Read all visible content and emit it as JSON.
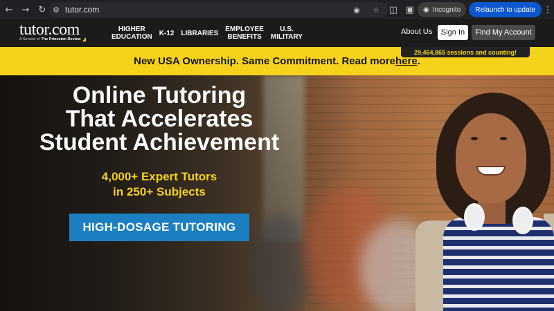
{
  "browser": {
    "url": "tutor.com",
    "incognito_label": "Incognito",
    "relaunch_label": "Relaunch to update"
  },
  "header": {
    "logo_text": "tutor.com",
    "logo_tagline_prefix": "A Service of",
    "logo_tagline_brand": "The Princeton Review",
    "nav": [
      {
        "label": "HIGHER\nEDUCATION"
      },
      {
        "label": "K-12"
      },
      {
        "label": "LIBRARIES"
      },
      {
        "label": "EMPLOYEE\nBENEFITS"
      },
      {
        "label": "U.S.\nMILITARY"
      }
    ],
    "about_label": "About Us",
    "signin_label": "Sign In",
    "find_account_label": "Find My Account",
    "sessions_text": "29,464,865 sessions and counting!"
  },
  "banner": {
    "text": "New USA Ownership. Same Commitment. Read more ",
    "link_text": "here",
    "suffix": "."
  },
  "hero": {
    "title_lines": [
      "Online Tutoring",
      "That Accelerates",
      "Student Achievement"
    ],
    "subtitle_lines": [
      "4,000+ Expert Tutors",
      "in 250+ Subjects"
    ],
    "cta_label": "HIGH-DOSAGE TUTORING"
  },
  "colors": {
    "accent_yellow": "#f5d31c",
    "cta_blue": "#1c7fc1",
    "header_bg": "#1b1b1b"
  }
}
